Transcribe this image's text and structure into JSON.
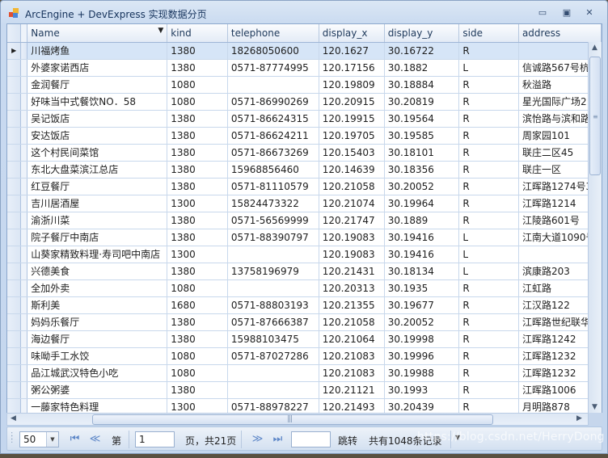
{
  "window": {
    "title": "ArcEngine + DevExpress 实现数据分页",
    "buttons": {
      "minimize": "▭",
      "restore": "▣",
      "close": "✕"
    },
    "icon": "app-form-icon"
  },
  "grid": {
    "columns": [
      "Name",
      "kind",
      "telephone",
      "display_x",
      "display_y",
      "side",
      "address"
    ],
    "filter_icon_column": "Name",
    "selected_row": 0,
    "rows": [
      [
        "川福烤鱼",
        "1380",
        "18268050600",
        "120.1627",
        "30.16722",
        "R",
        ""
      ],
      [
        "外婆家诺西店",
        "1380",
        "0571-87774995",
        "120.17156",
        "30.1882",
        "L",
        "信诚路567号杭"
      ],
      [
        "金润餐厅",
        "1080",
        "",
        "120.19809",
        "30.18884",
        "R",
        "秋溢路"
      ],
      [
        "好味当中式餐饮NO．58",
        "1080",
        "0571-86990269",
        "120.20915",
        "30.20819",
        "R",
        "星光国际广场2"
      ],
      [
        "吴记饭店",
        "1380",
        "0571-86624315",
        "120.19915",
        "30.19564",
        "R",
        "滨怡路与滨和路"
      ],
      [
        "安达饭店",
        "1380",
        "0571-86624211",
        "120.19705",
        "30.19585",
        "R",
        "周家园101"
      ],
      [
        "这个村民间菜馆",
        "1380",
        "0571-86673269",
        "120.15403",
        "30.18101",
        "R",
        "联庄二区45"
      ],
      [
        "东北大盘菜滨江总店",
        "1380",
        "15968856460",
        "120.14639",
        "30.18356",
        "R",
        "联庄一区"
      ],
      [
        "红豆餐厅",
        "1380",
        "0571-81110579",
        "120.21058",
        "30.20052",
        "R",
        "江晖路1274号3"
      ],
      [
        "吉川居酒屋",
        "1300",
        "15824473322",
        "120.21074",
        "30.19964",
        "R",
        "江晖路1214"
      ],
      [
        "渝浙川菜",
        "1380",
        "0571-56569999",
        "120.21747",
        "30.1889",
        "R",
        "江陵路601号"
      ],
      [
        "院子餐厅中南店",
        "1380",
        "0571-88390797",
        "120.19083",
        "30.19416",
        "L",
        "江南大道1090号"
      ],
      [
        "山葵家精致料理·寿司吧中南店",
        "1300",
        "",
        "120.19083",
        "30.19416",
        "L",
        ""
      ],
      [
        "兴德美食",
        "1380",
        "13758196979",
        "120.21431",
        "30.18134",
        "L",
        "滨康路203"
      ],
      [
        "全加外卖",
        "1080",
        "",
        "120.20313",
        "30.1935",
        "R",
        "江虹路"
      ],
      [
        "斯利美",
        "1680",
        "0571-88803193",
        "120.21355",
        "30.19677",
        "R",
        "江汉路122"
      ],
      [
        "妈妈乐餐厅",
        "1380",
        "0571-87666387",
        "120.21058",
        "30.20052",
        "R",
        "江晖路世纪联华"
      ],
      [
        "海边餐厅",
        "1380",
        "15988103475",
        "120.21064",
        "30.19998",
        "R",
        "江晖路1242"
      ],
      [
        "味呦手工水饺",
        "1080",
        "0571-87027286",
        "120.21083",
        "30.19996",
        "R",
        "江晖路1232"
      ],
      [
        "品江城武汉特色小吃",
        "1080",
        "",
        "120.21083",
        "30.19988",
        "R",
        "江晖路1232"
      ],
      [
        "粥公粥婆",
        "1380",
        "",
        "120.21121",
        "30.1993",
        "R",
        "江晖路1006"
      ],
      [
        "一藤家特色料理",
        "1300",
        "0571-88978227",
        "120.21493",
        "30.20439",
        "R",
        "月明路878"
      ]
    ]
  },
  "pager": {
    "page_size": "50",
    "page_label_prefix": "第",
    "current_page": "1",
    "page_label_suffix": "页，共21页",
    "jump_input": "",
    "jump_label": "跳转",
    "record_count": "共有1048条记录",
    "icons": {
      "first": "⏮",
      "prev": "≪",
      "next": "≫",
      "last": "⏭"
    }
  },
  "watermark": "https://blog.csdn.net/HerryDong"
}
